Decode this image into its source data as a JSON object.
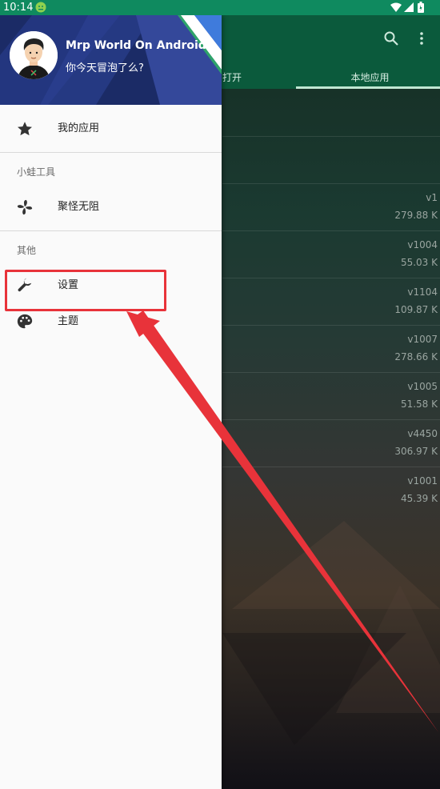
{
  "status_bar": {
    "time": "10:14",
    "app_icon": "android-robot-icon",
    "icons": [
      "wifi-icon",
      "signal-icon",
      "battery-icon"
    ]
  },
  "drawer": {
    "profile": {
      "name": "Mrp World On Android",
      "subtitle": "你今天冒泡了么?"
    },
    "items": [
      {
        "label": "我的应用",
        "icon": "star-icon"
      },
      {
        "label": "聚怪无阻",
        "icon": "pinwheel-icon"
      },
      {
        "label": "设置",
        "icon": "wrench-icon"
      },
      {
        "label": "主题",
        "icon": "palette-icon"
      }
    ],
    "sections": [
      {
        "label": "小蛙工具"
      },
      {
        "label": "其他"
      }
    ]
  },
  "background": {
    "tabs": [
      "打开",
      "本地应用"
    ],
    "rows": [
      {
        "version": "",
        "size": ""
      },
      {
        "version": "",
        "size": ""
      },
      {
        "version": "v1",
        "size": "279.88 K"
      },
      {
        "version": "v1004",
        "size": "55.03 K"
      },
      {
        "version": "v1104",
        "size": "109.87 K"
      },
      {
        "version": "v1007",
        "size": "278.66 K"
      },
      {
        "version": "v1005",
        "size": "51.58 K"
      },
      {
        "version": "v4450",
        "size": "306.97 K"
      },
      {
        "version": "v1001",
        "size": "45.39 K"
      }
    ]
  },
  "colors": {
    "status_bar": "#0f8a5f",
    "toolbar": "#0b5a3c",
    "drawer_bg": "#fafafa",
    "annotation": "#e8333a"
  }
}
